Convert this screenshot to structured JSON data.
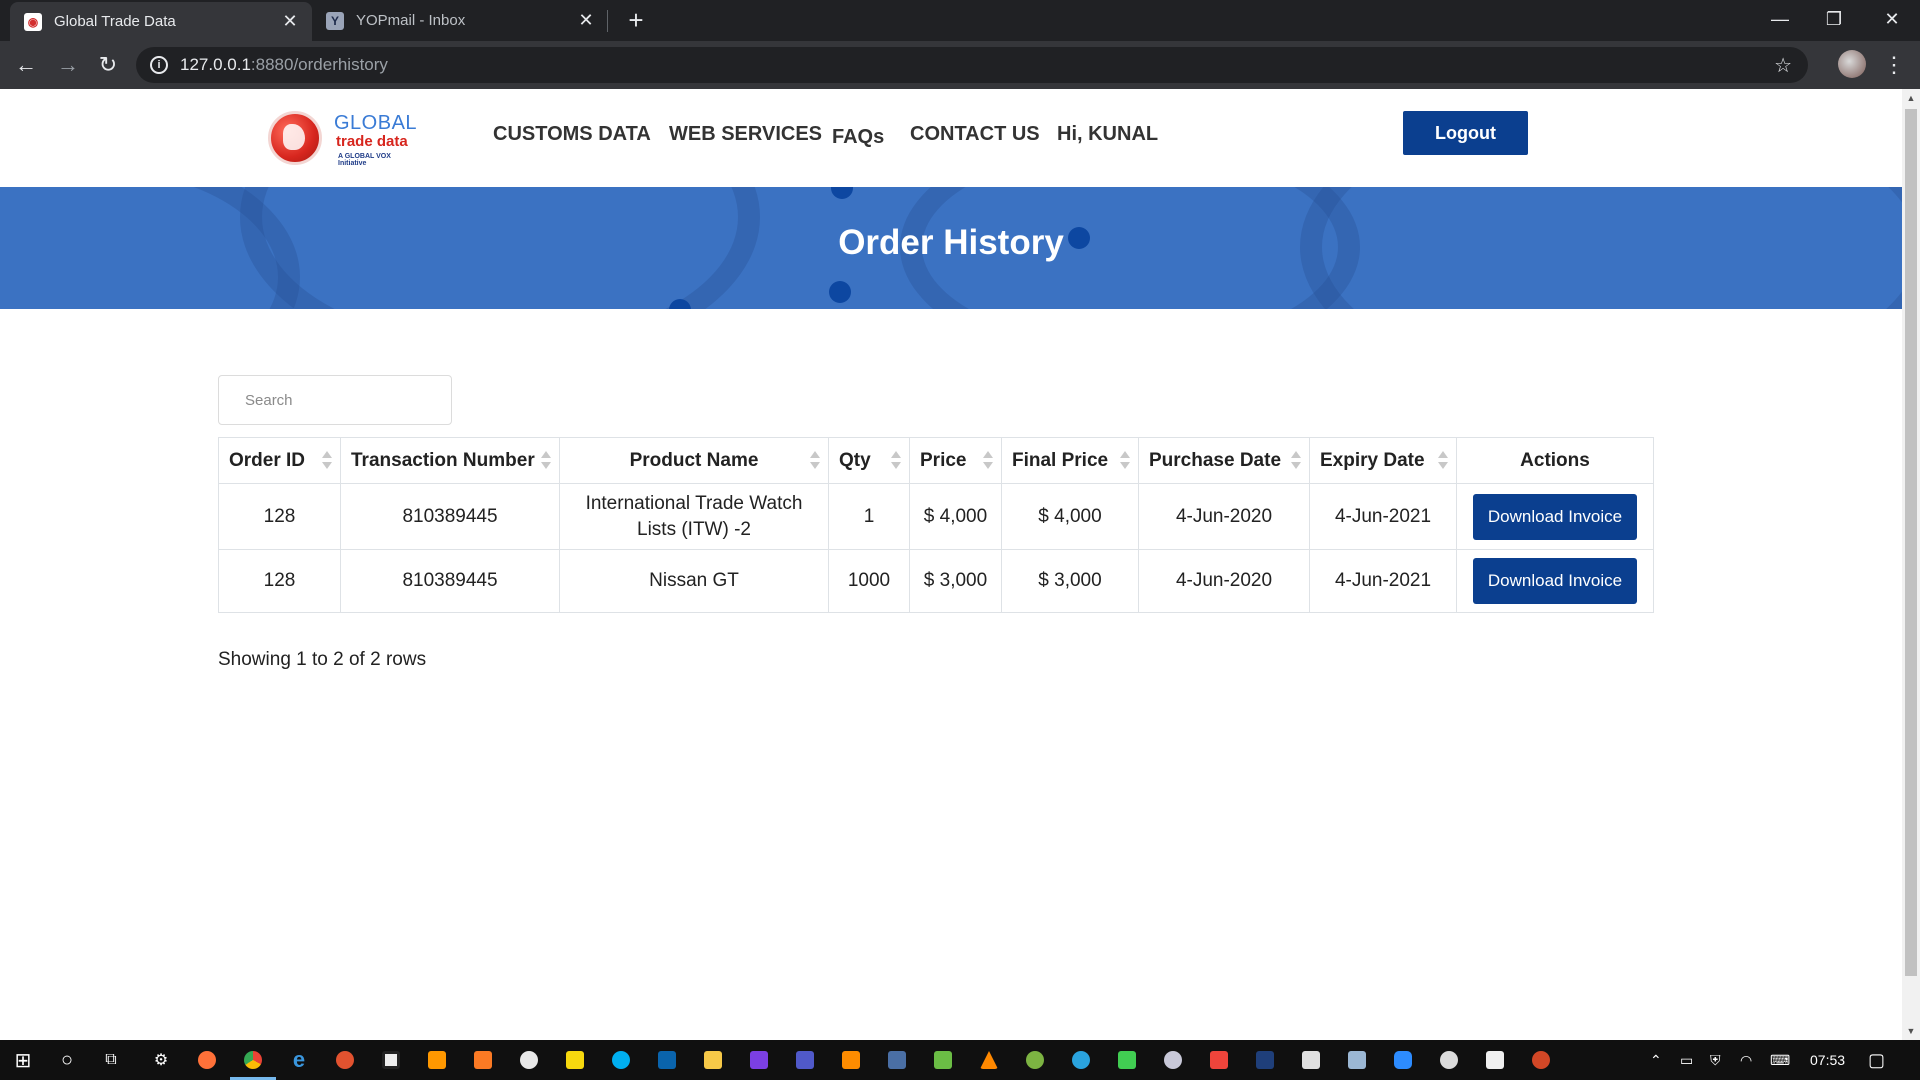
{
  "browser": {
    "tabs": [
      {
        "title": "Global Trade Data",
        "active": true,
        "favicon": "globe-favicon"
      },
      {
        "title": "YOPmail - Inbox",
        "active": false,
        "favicon": "yopmail-favicon"
      }
    ],
    "url_host": "127.0.0.1",
    "url_rest": ":8880/orderhistory"
  },
  "site": {
    "logo": {
      "line1": "GLOBAL",
      "line2": "trade data",
      "line3": "A GLOBAL VOX Initiative"
    },
    "nav": [
      {
        "label": "CUSTOMS DATA"
      },
      {
        "label": "WEB SERVICES"
      },
      {
        "label": "FAQs"
      },
      {
        "label": "CONTACT US"
      },
      {
        "label": "Hi, KUNAL"
      }
    ],
    "logout_label": "Logout",
    "banner_title": "Order History",
    "search_placeholder": "Search",
    "table": {
      "headers": [
        "Order ID",
        "Transaction Number",
        "Product Name",
        "Qty",
        "Price",
        "Final Price",
        "Purchase Date",
        "Expiry Date",
        "Actions"
      ],
      "rows": [
        {
          "order_id": "128",
          "transaction": "810389445",
          "product": "International Trade Watch Lists (ITW) -2",
          "qty": "1",
          "price": "$ 4,000",
          "final_price": "$ 4,000",
          "purchase_date": "4-Jun-2020",
          "expiry_date": "4-Jun-2021",
          "action": "Download Invoice"
        },
        {
          "order_id": "128",
          "transaction": "810389445",
          "product": "Nissan GT",
          "qty": "1000",
          "price": "$ 3,000",
          "final_price": "$ 3,000",
          "purchase_date": "4-Jun-2020",
          "expiry_date": "4-Jun-2021",
          "action": "Download Invoice"
        }
      ]
    },
    "pagination_info": "Showing 1 to 2 of 2 rows"
  },
  "taskbar": {
    "clock": "07:53"
  },
  "colors": {
    "brand_blue": "#0b3f8f",
    "banner_blue": "#3b72c2",
    "logo_red": "#d7261e"
  }
}
